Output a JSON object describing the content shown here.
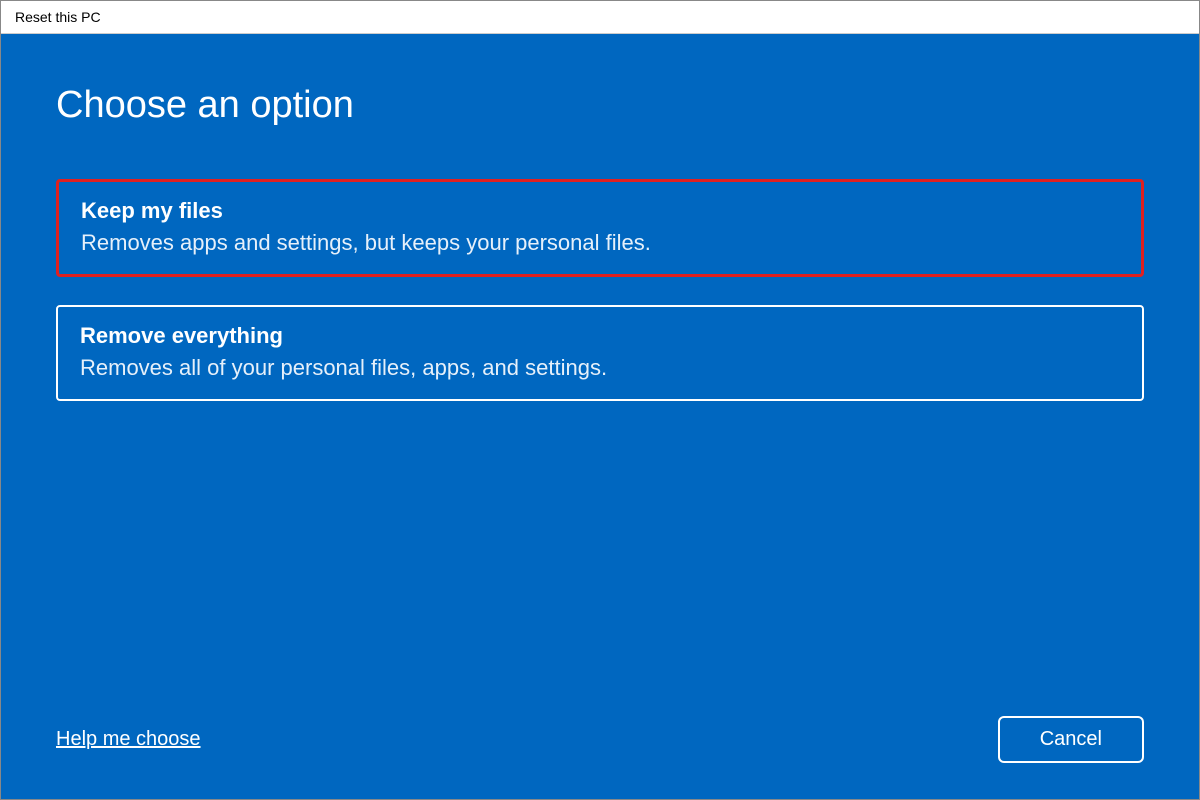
{
  "window": {
    "title": "Reset this PC"
  },
  "main": {
    "heading": "Choose an option",
    "options": [
      {
        "title": "Keep my files",
        "description": "Removes apps and settings, but keeps your personal files.",
        "highlighted": true
      },
      {
        "title": "Remove everything",
        "description": "Removes all of your personal files, apps, and settings.",
        "highlighted": false
      }
    ]
  },
  "footer": {
    "help_link": "Help me choose",
    "cancel_label": "Cancel"
  },
  "colors": {
    "primary": "#0067c0",
    "highlight_border": "#e02020"
  }
}
